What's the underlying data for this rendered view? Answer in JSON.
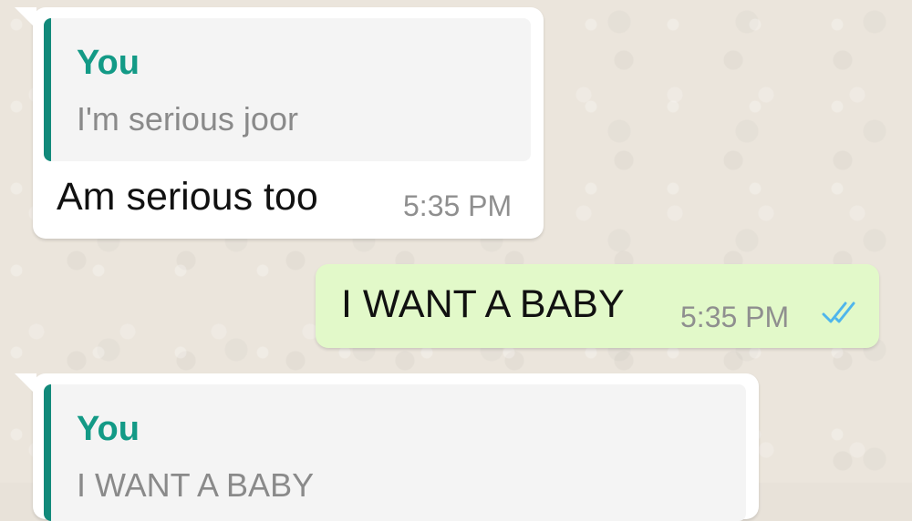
{
  "conversation": {
    "messages": [
      {
        "direction": "incoming",
        "quote": {
          "author": "You",
          "text": "I'm serious joor"
        },
        "text": "Am serious too",
        "time": "5:35 PM"
      },
      {
        "direction": "outgoing",
        "text": "I WANT A BABY",
        "time": "5:35 PM",
        "status": "read",
        "status_icon": "double-check-icon"
      },
      {
        "direction": "incoming",
        "quote": {
          "author": "You",
          "text": "I WANT A BABY"
        }
      }
    ]
  },
  "colors": {
    "quote_accent": "#12897a",
    "quote_author": "#139a86",
    "outgoing_bubble": "#e2f9c9",
    "incoming_bubble": "#ffffff",
    "read_ticks": "#4fb6ec",
    "wallpaper": "#ebe5dc"
  }
}
